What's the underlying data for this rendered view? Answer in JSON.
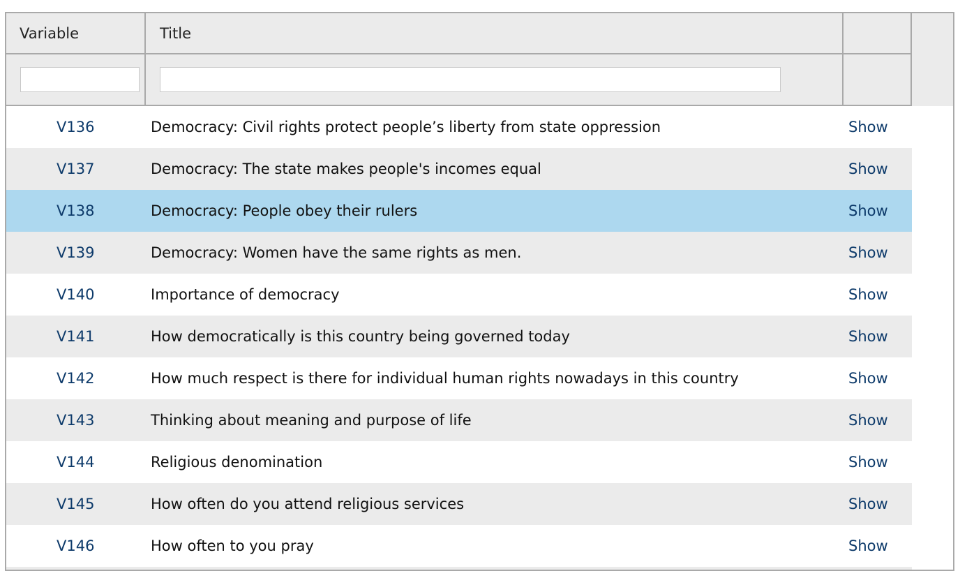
{
  "table": {
    "columns": {
      "variable": "Variable",
      "title": "Title",
      "actions": ""
    },
    "filters": {
      "variable_value": "",
      "title_value": ""
    },
    "rows": [
      {
        "variable": "V136",
        "title": "Democracy: Civil rights protect people’s liberty from state oppression",
        "action": "Show",
        "selected": false
      },
      {
        "variable": "V137",
        "title": "Democracy: The state makes people's incomes equal",
        "action": "Show",
        "selected": false
      },
      {
        "variable": "V138",
        "title": "Democracy: People obey their rulers",
        "action": "Show",
        "selected": true
      },
      {
        "variable": "V139",
        "title": "Democracy: Women have the same rights as men.",
        "action": "Show",
        "selected": false
      },
      {
        "variable": "V140",
        "title": "Importance of democracy",
        "action": "Show",
        "selected": false
      },
      {
        "variable": "V141",
        "title": "How democratically is this country being governed today",
        "action": "Show",
        "selected": false
      },
      {
        "variable": "V142",
        "title": "How much respect is there for individual human rights nowadays in this country",
        "action": "Show",
        "selected": false
      },
      {
        "variable": "V143",
        "title": "Thinking about meaning and purpose of life",
        "action": "Show",
        "selected": false
      },
      {
        "variable": "V144",
        "title": "Religious denomination",
        "action": "Show",
        "selected": false
      },
      {
        "variable": "V145",
        "title": "How often do you attend religious services",
        "action": "Show",
        "selected": false
      },
      {
        "variable": "V146",
        "title": "How often to you pray",
        "action": "Show",
        "selected": false
      }
    ]
  },
  "colors": {
    "header_bg": "#ebebeb",
    "alt_row_bg": "#ebebeb",
    "selected_row_bg": "#add8ef",
    "link": "#0d3a6a",
    "border": "#a9a9a9"
  }
}
